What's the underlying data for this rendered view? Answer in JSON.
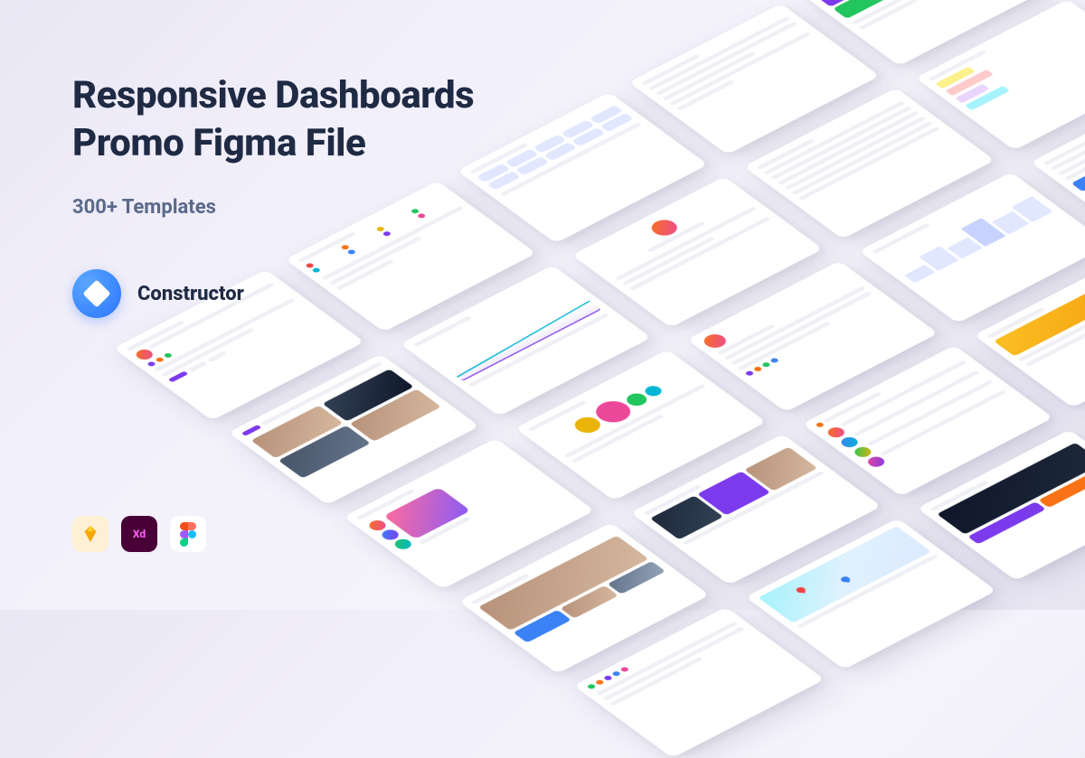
{
  "headline_line1": "Responsive Dashboards",
  "headline_line2": "Promo Figma File",
  "subhead": "300+ Templates",
  "brand": {
    "name": "Constructor"
  },
  "tools": {
    "sketch": "Sketch",
    "xd": "Xd",
    "figma": "Figma"
  },
  "colors": {
    "purple": "#7c3aed",
    "orange": "#f97316",
    "pink": "#ec4899",
    "blue": "#3b82f6",
    "green": "#22c55e",
    "cyan": "#06b6d4",
    "yellow": "#eab308"
  }
}
